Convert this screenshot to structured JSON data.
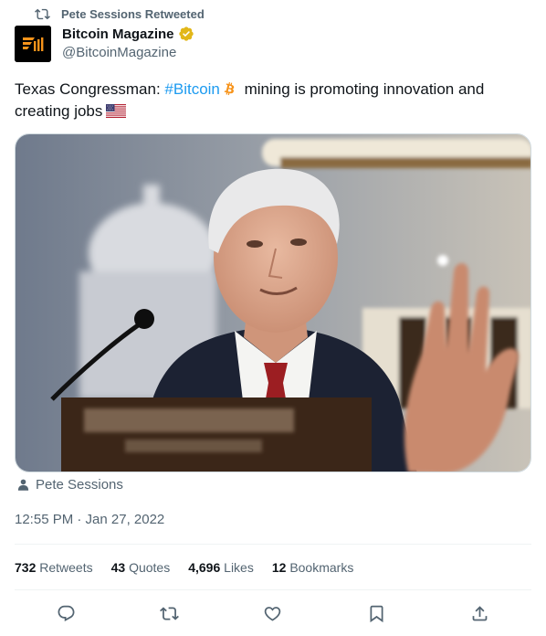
{
  "retweet_context": {
    "text": "Pete Sessions Retweeted",
    "icon": "retweet-icon"
  },
  "author": {
    "name": "Bitcoin Magazine",
    "handle": "@BitcoinMagazine",
    "verified_color": "#e2b719"
  },
  "tweet": {
    "text_before": "Texas Congressman: ",
    "hashtag": "#Bitcoin",
    "text_after": " mining is promoting innovation and creating jobs",
    "emoji": [
      "bitcoin-icon",
      "us-flag-icon"
    ]
  },
  "media": {
    "credit": "Pete Sessions",
    "credit_icon": "person-icon"
  },
  "timestamp": "12:55 PM · Jan 27, 2022",
  "stats": [
    {
      "number": "732",
      "label": "Retweets"
    },
    {
      "number": "43",
      "label": "Quotes"
    },
    {
      "number": "4,696",
      "label": "Likes"
    },
    {
      "number": "12",
      "label": "Bookmarks"
    }
  ],
  "actions": [
    "reply-icon",
    "retweet-icon",
    "like-icon",
    "bookmark-icon",
    "share-icon"
  ],
  "colors": {
    "link": "#1d9bf0",
    "secondary_text": "#536471",
    "bitcoin": "#f7931a"
  }
}
